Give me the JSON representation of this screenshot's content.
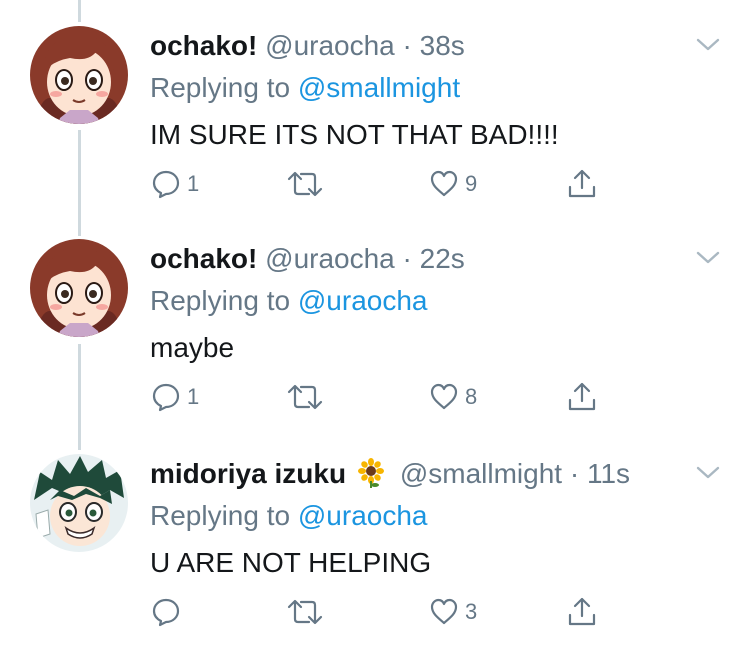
{
  "colors": {
    "text": "#14171a",
    "secondary": "#657786",
    "link": "#1b95e0",
    "line": "#cfd9de"
  },
  "tweets": [
    {
      "name": "ochako!",
      "handle": "@uraocha",
      "dot": "·",
      "time": "38s",
      "replying_prefix": "Replying to ",
      "replying_to": "@smallmight",
      "text": "IM SURE ITS NOT THAT BAD!!!!",
      "avatar": "ochako-avatar",
      "reply_count": "1",
      "like_count": "9"
    },
    {
      "name": "ochako!",
      "handle": "@uraocha",
      "dot": "·",
      "time": "22s",
      "replying_prefix": "Replying to ",
      "replying_to": "@uraocha",
      "text": "maybe",
      "avatar": "ochako-avatar",
      "reply_count": "1",
      "like_count": "8"
    },
    {
      "name": "midoriya izuku",
      "name_emoji": "sunflower-emoji",
      "handle": "@smallmight",
      "dot": "·",
      "time": "11s",
      "replying_prefix": "Replying to ",
      "replying_to": "@uraocha",
      "text": "U ARE NOT HELPING",
      "avatar": "izuku-avatar",
      "reply_count": "",
      "like_count": "3"
    }
  ],
  "icons": [
    "reply-icon",
    "retweet-icon",
    "like-icon",
    "share-icon",
    "chevron-down-icon"
  ]
}
